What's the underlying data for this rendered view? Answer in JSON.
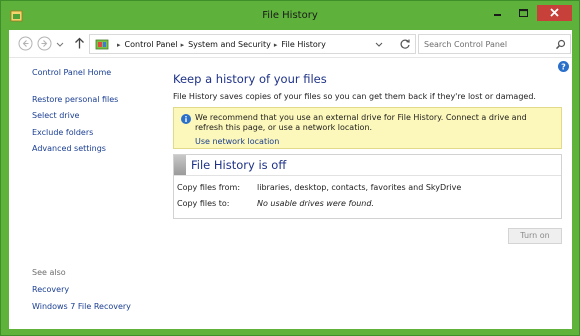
{
  "window": {
    "title": "File History"
  },
  "nav": {
    "breadcrumbs": [
      "Control Panel",
      "System and Security",
      "File History"
    ],
    "search_placeholder": "Search Control Panel"
  },
  "sidebar": {
    "home": "Control Panel Home",
    "links": [
      "Restore personal files",
      "Select drive",
      "Exclude folders",
      "Advanced settings"
    ],
    "see_also_label": "See also",
    "see_also": [
      "Recovery",
      "Windows 7 File Recovery"
    ]
  },
  "main": {
    "heading": "Keep a history of your files",
    "description": "File History saves copies of your files so you can get them back if they're lost or damaged.",
    "info": {
      "message": "We recommend that you use an external drive for File History. Connect a drive and refresh this page, or use a network location.",
      "link": "Use network location"
    },
    "status": {
      "title": "File History is off",
      "rows": [
        {
          "label": "Copy files from:",
          "value": "libraries, desktop, contacts, favorites and SkyDrive"
        },
        {
          "label": "Copy files to:",
          "value": "No usable drives were found."
        }
      ]
    },
    "turn_on_button": "Turn on"
  },
  "colors": {
    "frame": "#5fb33a",
    "close_button": "#c7413a",
    "link": "#1a3e92",
    "heading": "#1e3287",
    "info_background": "#fcf7ba"
  }
}
